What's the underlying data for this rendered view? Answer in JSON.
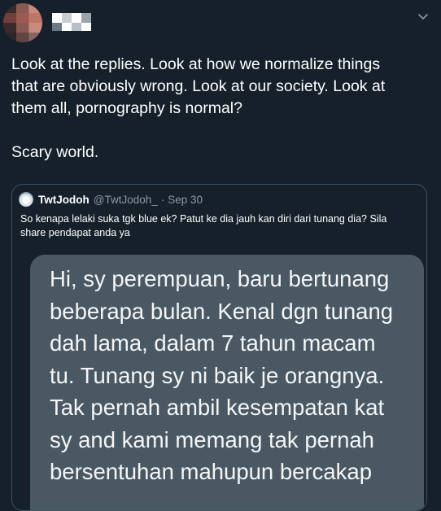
{
  "tweet": {
    "body_lines": [
      "Look at the replies. Look at how we normalize things",
      "that are obviously wrong. Look at our society. Look at",
      "them all, pornography is normal?"
    ],
    "closing": "Scary world.",
    "more_icon": "chevron-down-icon"
  },
  "quoted": {
    "name": "TwtJodoh",
    "handle": "@TwtJodoh_",
    "separator": "·",
    "date": "Sep 30",
    "text_lines": [
      "So kenapa lelaki suka tgk blue ek? Patut ke dia jauh kan diri dari tunang dia? Sila",
      "share pendapat anda ya"
    ],
    "image_lines": [
      "Hi, sy perempuan, baru bertunang",
      "beberapa bulan. Kenal dgn tunang",
      "dah lama, dalam 7 tahun macam",
      "tu. Tunang sy ni baik je orangnya.",
      "Tak pernah ambil kesempatan kat",
      "sy and kami memang tak pernah",
      "bersentuhan mahupun bercakap"
    ]
  },
  "colors": {
    "background": "#15202b",
    "secondary_text": "#8899a6",
    "border": "#3d5466",
    "bubble": "#4a5863"
  }
}
